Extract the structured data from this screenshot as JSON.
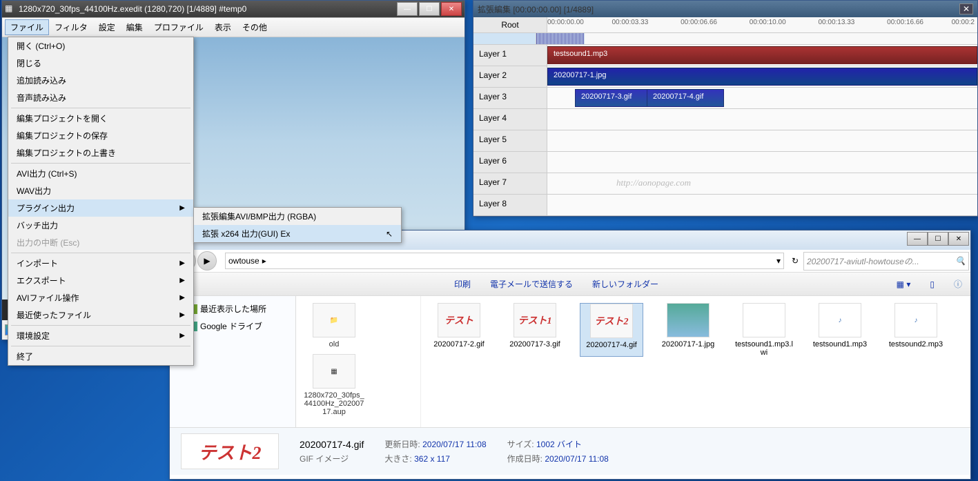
{
  "main_window": {
    "title": "1280x720_30fps_44100Hz.exedit (1280,720)  [1/4889]  #temp0",
    "menu": [
      "ファイル",
      "フィルタ",
      "設定",
      "編集",
      "プロファイル",
      "表示",
      "その他"
    ],
    "file_menu": {
      "open": "開く (Ctrl+O)",
      "close": "閉じる",
      "add_read": "追加読み込み",
      "audio_read": "音声読み込み",
      "open_proj": "編集プロジェクトを開く",
      "save_proj": "編集プロジェクトの保存",
      "overwrite_proj": "編集プロジェクトの上書き",
      "avi_out": "AVI出力 (Ctrl+S)",
      "wav_out": "WAV出力",
      "plugin_out": "プラグイン出力",
      "batch_out": "バッチ出力",
      "abort": "出力の中断 (Esc)",
      "import": "インポート",
      "export": "エクスポート",
      "avi_ops": "AVIファイル操作",
      "recent": "最近使ったファイル",
      "env": "環境設定",
      "exit": "終了"
    },
    "plugin_submenu": {
      "avi_bmp": "拡張編集AVI/BMP出力 (RGBA)",
      "x264": "拡張 x264 出力(GUI) Ex"
    }
  },
  "timeline": {
    "title": "拡張編集 [00:00:00.00] [1/4889]",
    "root": "Root",
    "ticks": [
      "00:00:00.00",
      "00:00:03.33",
      "00:00:06.66",
      "00:00:10.00",
      "00:00:13.33",
      "00:00:16.66",
      "00:00:2"
    ],
    "layers": [
      "Layer 1",
      "Layer 2",
      "Layer 3",
      "Layer 4",
      "Layer 5",
      "Layer 6",
      "Layer 7",
      "Layer 8"
    ],
    "clips": {
      "audio": "testsound1.mp3",
      "image": "20200717-1.jpg",
      "gif1": "20200717-3.gif",
      "gif2": "20200717-4.gif"
    },
    "watermark": "http://aonopage.com"
  },
  "explorer": {
    "breadcrumb": "owtouse",
    "search_placeholder": "20200717-aviutl-howtouseの...",
    "toolbar": {
      "print": "印刷",
      "email": "電子メールで送信する",
      "newfolder": "新しいフォルダー"
    },
    "sidebar": {
      "recent": "最近表示した場所",
      "gdrive": "Google ドライブ"
    },
    "other": {
      "old": "old",
      "aup": "1280x720_30fps_44100Hz_20200717.aup"
    },
    "files": [
      {
        "thumb_text": "テスト",
        "name": "20200717-2.gif",
        "type": "test"
      },
      {
        "thumb_text": "テスト1",
        "name": "20200717-3.gif",
        "type": "test"
      },
      {
        "thumb_text": "テスト2",
        "name": "20200717-4.gif",
        "type": "test",
        "selected": true
      },
      {
        "thumb_text": "",
        "name": "20200717-1.jpg",
        "type": "sky"
      },
      {
        "thumb_text": "",
        "name": "testsound1.mp3.lwi",
        "type": "doc"
      },
      {
        "thumb_text": "♪",
        "name": "testsound1.mp3",
        "type": "audio"
      },
      {
        "thumb_text": "♪",
        "name": "testsound2.mp3",
        "type": "audio"
      }
    ],
    "details": {
      "thumb": "テスト2",
      "filename": "20200717-4.gif",
      "filetype": "GIF イメージ",
      "mod_label": "更新日時:",
      "mod_val": "2020/07/17 11:08",
      "dim_label": "大きさ:",
      "dim_val": "362 x 117",
      "size_label": "サイズ:",
      "size_val": "1002 バイト",
      "create_label": "作成日時:",
      "create_val": "2020/07/17 11:08"
    }
  }
}
